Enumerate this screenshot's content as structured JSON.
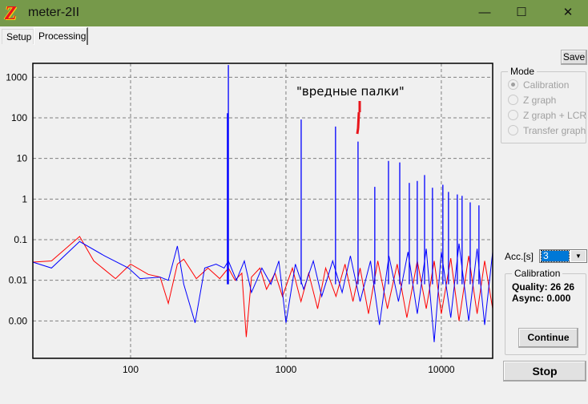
{
  "window": {
    "title": "meter-2II",
    "logo_letter": "Z",
    "minimize": "—",
    "maximize": "☐",
    "close": "✕"
  },
  "tabs": [
    {
      "label": "Setup",
      "active": false
    },
    {
      "label": "Processing",
      "active": true
    }
  ],
  "save_label": "Save",
  "mode": {
    "legend": "Mode",
    "options": [
      {
        "label": "Calibration",
        "selected": true,
        "enabled": false
      },
      {
        "label": "Z graph",
        "selected": false,
        "enabled": false
      },
      {
        "label": "Z graph + LCR",
        "selected": false,
        "enabled": false
      },
      {
        "label": "Transfer graph",
        "selected": false,
        "enabled": false
      }
    ]
  },
  "acc": {
    "label": "Acc.[s]",
    "value": "3"
  },
  "calibration": {
    "legend": "Calibration",
    "quality": "Quality: 26 26",
    "async": "Async: 0.000",
    "continue_label": "Continue"
  },
  "stop_label": "Stop",
  "colors": {
    "titlebar": "#76994a",
    "series_red": "#ff0000",
    "series_blue": "#0000ff",
    "annotation": "#e8151b"
  },
  "chart_data": {
    "type": "line",
    "x_scale": "log",
    "y_scale": "log",
    "xlim": [
      23.5,
      21400
    ],
    "ylim": [
      0.00012,
      2200
    ],
    "x_ticks": [
      {
        "v": 100,
        "label": "100"
      },
      {
        "v": 1000,
        "label": "1000"
      },
      {
        "v": 10000,
        "label": "10000"
      }
    ],
    "y_ticks": [
      {
        "v": 1000,
        "label": "1000"
      },
      {
        "v": 100,
        "label": "100"
      },
      {
        "v": 10,
        "label": "10"
      },
      {
        "v": 1,
        "label": "1"
      },
      {
        "v": 0.1,
        "label": "0.1"
      },
      {
        "v": 0.01,
        "label": "0.01"
      },
      {
        "v": 0.001,
        "label": "0.00"
      }
    ],
    "grid": true,
    "annotation": "\"вредные палки\"",
    "series": [
      {
        "color": "red",
        "points": [
          [
            23.5,
            0.028
          ],
          [
            31,
            0.03
          ],
          [
            47,
            0.12
          ],
          [
            58,
            0.03
          ],
          [
            80,
            0.011
          ],
          [
            100,
            0.025
          ],
          [
            130,
            0.014
          ],
          [
            155,
            0.012
          ],
          [
            175,
            0.0027
          ],
          [
            200,
            0.025
          ],
          [
            220,
            0.033
          ],
          [
            265,
            0.011
          ],
          [
            315,
            0.02
          ],
          [
            375,
            0.011
          ],
          [
            426,
            0.02
          ],
          [
            470,
            0.01
          ],
          [
            520,
            0.015
          ],
          [
            555,
            0.0004
          ],
          [
            600,
            0.012
          ],
          [
            680,
            0.02
          ],
          [
            750,
            0.006
          ],
          [
            850,
            0.015
          ],
          [
            950,
            0.004
          ],
          [
            1100,
            0.02
          ],
          [
            1250,
            0.003
          ],
          [
            1400,
            0.015
          ],
          [
            1600,
            0.002
          ],
          [
            1800,
            0.02
          ],
          [
            2100,
            0.004
          ],
          [
            2400,
            0.025
          ],
          [
            2700,
            0.003
          ],
          [
            3000,
            0.02
          ],
          [
            3400,
            0.0015
          ],
          [
            3900,
            0.03
          ],
          [
            4500,
            0.002
          ],
          [
            5200,
            0.025
          ],
          [
            6000,
            0.0012
          ],
          [
            7000,
            0.03
          ],
          [
            8000,
            0.002
          ],
          [
            9000,
            0.03
          ],
          [
            10000,
            0.0015
          ],
          [
            11500,
            0.035
          ],
          [
            13000,
            0.001
          ],
          [
            15000,
            0.04
          ],
          [
            17000,
            0.0015
          ],
          [
            19000,
            0.03
          ],
          [
            21400,
            0.002
          ]
        ]
      },
      {
        "color": "blue",
        "points": [
          [
            23.5,
            0.028
          ],
          [
            31,
            0.02
          ],
          [
            47,
            0.09
          ],
          [
            68,
            0.04
          ],
          [
            97,
            0.02
          ],
          [
            115,
            0.011
          ],
          [
            155,
            0.012
          ],
          [
            175,
            0.01
          ],
          [
            200,
            0.07
          ],
          [
            220,
            0.008
          ],
          [
            260,
            0.0009
          ],
          [
            300,
            0.02
          ],
          [
            355,
            0.025
          ],
          [
            400,
            0.02
          ],
          [
            426,
            0.03
          ],
          [
            480,
            0.01
          ],
          [
            540,
            0.03
          ],
          [
            600,
            0.005
          ],
          [
            700,
            0.02
          ],
          [
            800,
            0.008
          ],
          [
            900,
            0.03
          ],
          [
            1000,
            0.0009
          ],
          [
            1150,
            0.025
          ],
          [
            1300,
            0.006
          ],
          [
            1500,
            0.03
          ],
          [
            1700,
            0.004
          ],
          [
            2000,
            0.03
          ],
          [
            2300,
            0.005
          ],
          [
            2600,
            0.04
          ],
          [
            3000,
            0.003
          ],
          [
            3500,
            0.03
          ],
          [
            4000,
            0.0008
          ],
          [
            4600,
            0.04
          ],
          [
            5300,
            0.003
          ],
          [
            6100,
            0.05
          ],
          [
            7000,
            0.0015
          ],
          [
            8000,
            0.06
          ],
          [
            9000,
            0.0003
          ],
          [
            10000,
            0.05
          ],
          [
            11500,
            0.0012
          ],
          [
            13000,
            0.08
          ],
          [
            15000,
            0.001
          ],
          [
            17000,
            0.06
          ],
          [
            19000,
            0.0008
          ],
          [
            21400,
            0.05
          ]
        ]
      }
    ],
    "peaks": [
      [
        420,
        130
      ],
      [
        426,
        2000
      ],
      [
        1253,
        91
      ],
      [
        2085,
        61
      ],
      [
        2910,
        26
      ],
      [
        3730,
        2
      ],
      [
        4570,
        8.7
      ],
      [
        5400,
        8
      ],
      [
        6220,
        2.5
      ],
      [
        7000,
        2.8
      ],
      [
        7800,
        3.9
      ],
      [
        8770,
        1.9
      ],
      [
        10230,
        2.25
      ],
      [
        11120,
        1.5
      ],
      [
        12670,
        1.3
      ],
      [
        13600,
        1.2
      ],
      [
        15340,
        0.83
      ],
      [
        17460,
        0.7
      ]
    ]
  }
}
